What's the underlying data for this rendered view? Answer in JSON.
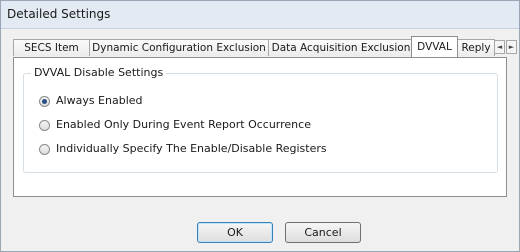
{
  "window": {
    "title": "Detailed Settings"
  },
  "tabs": [
    {
      "label": "SECS Item",
      "active": false
    },
    {
      "label": "Dynamic Configuration Exclusion",
      "active": false
    },
    {
      "label": "Data Acquisition Exclusion",
      "active": false
    },
    {
      "label": "DVVAL",
      "active": true
    },
    {
      "label": "Reply",
      "active": false
    }
  ],
  "tab_scroll": {
    "left_icon": "arrow-left-icon",
    "right_icon": "arrow-right-icon",
    "left_glyph": "◄",
    "right_glyph": "►"
  },
  "group": {
    "title": "DVVAL Disable Settings",
    "options": [
      {
        "label": "Always Enabled",
        "checked": true
      },
      {
        "label": "Enabled Only During Event Report Occurrence",
        "checked": false
      },
      {
        "label": "Individually Specify The Enable/Disable Registers",
        "checked": false
      }
    ]
  },
  "buttons": {
    "ok": "OK",
    "cancel": "Cancel"
  }
}
